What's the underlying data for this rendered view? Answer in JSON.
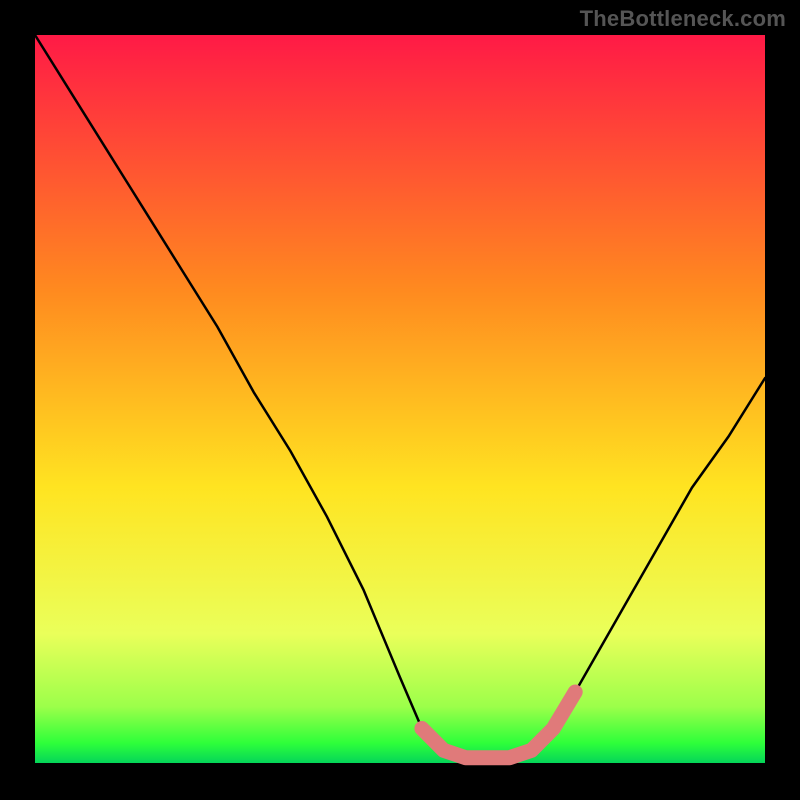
{
  "watermark": "TheBottleneck.com",
  "colors": {
    "background_black": "#000000",
    "gradient_top": "#ff1a46",
    "gradient_mid_orange": "#ff8a1f",
    "gradient_mid_yellow": "#ffe421",
    "gradient_low_yellowgreen": "#eaff5a",
    "gradient_green_light": "#9cff4a",
    "gradient_green": "#2eff3a",
    "gradient_green_deep": "#00d15c",
    "curve": "#000000",
    "highlight": "#e07a7a"
  },
  "chart_data": {
    "type": "line",
    "title": "",
    "xlabel": "",
    "ylabel": "",
    "x": [
      0.0,
      0.05,
      0.1,
      0.15,
      0.2,
      0.25,
      0.3,
      0.35,
      0.4,
      0.45,
      0.5,
      0.53,
      0.56,
      0.59,
      0.62,
      0.65,
      0.68,
      0.71,
      0.74,
      0.78,
      0.82,
      0.86,
      0.9,
      0.95,
      1.0
    ],
    "values": [
      1.0,
      0.92,
      0.84,
      0.76,
      0.68,
      0.6,
      0.51,
      0.43,
      0.34,
      0.24,
      0.12,
      0.05,
      0.02,
      0.01,
      0.01,
      0.01,
      0.02,
      0.05,
      0.1,
      0.17,
      0.24,
      0.31,
      0.38,
      0.45,
      0.53
    ],
    "highlight_x": [
      0.53,
      0.56,
      0.59,
      0.62,
      0.65,
      0.68,
      0.71,
      0.74
    ],
    "highlight_y": [
      0.05,
      0.02,
      0.01,
      0.01,
      0.01,
      0.02,
      0.05,
      0.1
    ],
    "xlim": [
      0,
      1
    ],
    "ylim": [
      0,
      1
    ]
  }
}
